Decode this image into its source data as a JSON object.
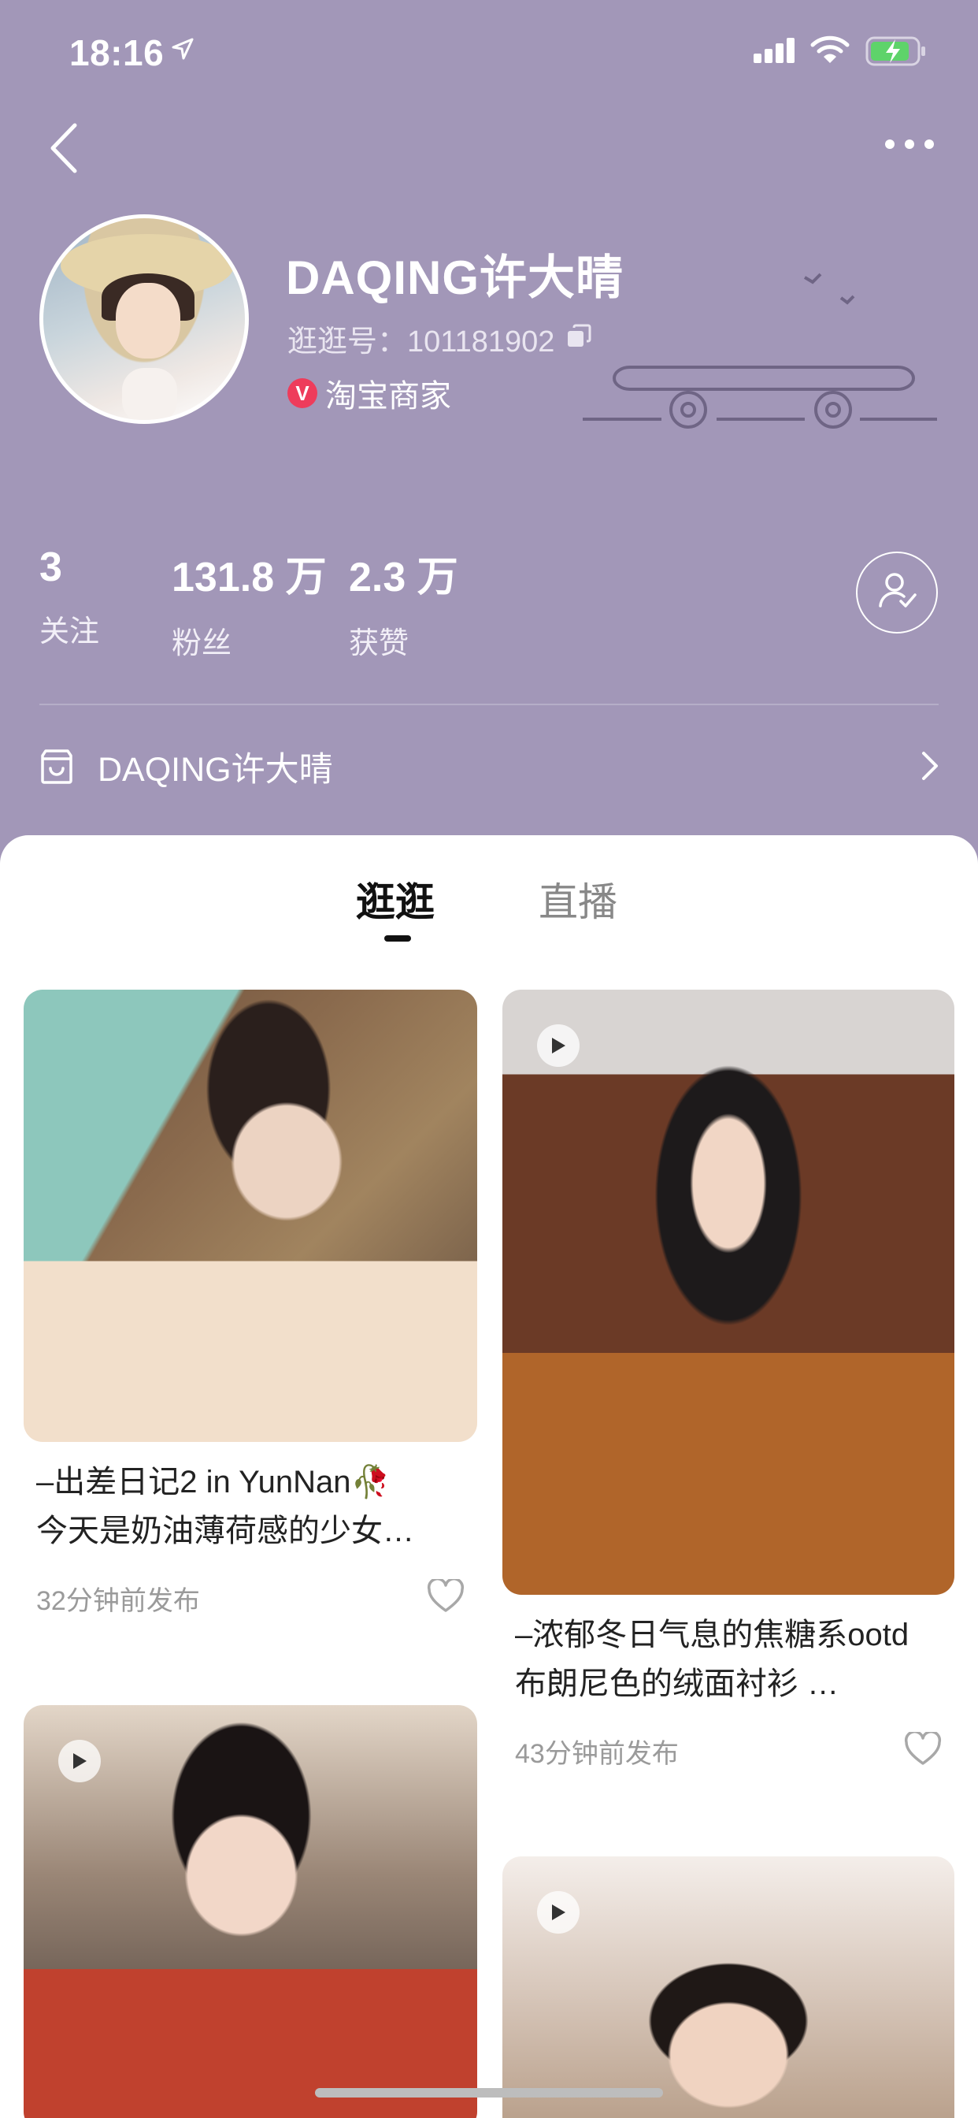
{
  "status_bar": {
    "time": "18:16"
  },
  "profile": {
    "name": "DAQING许大晴",
    "id_text": "逛逛号：101181902",
    "merchant_badge": "V",
    "merchant_label": "淘宝商家"
  },
  "stats": [
    {
      "value": "3",
      "label": "关注"
    },
    {
      "value": "131.8 万",
      "label": "粉丝"
    },
    {
      "value": "2.3 万",
      "label": "获赞"
    }
  ],
  "shop": {
    "name": "DAQING许大晴"
  },
  "tabs": [
    {
      "label": "逛逛",
      "active": true
    },
    {
      "label": "直播",
      "active": false
    }
  ],
  "feed": [
    {
      "title_line1": "–出差日记2 in YunNan🥀",
      "title_line2": "今天是奶油薄荷感的少女…",
      "time": "32分钟前发布",
      "video": false
    },
    {
      "title_line1": "–浓郁冬日气息的焦糖系ootd",
      "title_line2": "布朗尼色的绒面衬衫 …",
      "time": "43分钟前发布",
      "video": true
    },
    {
      "video": true
    },
    {
      "video": true
    }
  ],
  "icons": {
    "back": "chevron-left-icon",
    "more": "more-dots-icon",
    "copy": "copy-icon",
    "follow": "user-check-icon",
    "shop": "shop-icon",
    "shop_chevron": "chevron-right-icon",
    "like": "heart-icon",
    "play": "play-icon"
  },
  "colors": {
    "header_bg": "#a297b8",
    "merchant_red": "#ee3c5b",
    "text_dark": "#222222",
    "text_muted": "#9a9a9a"
  }
}
